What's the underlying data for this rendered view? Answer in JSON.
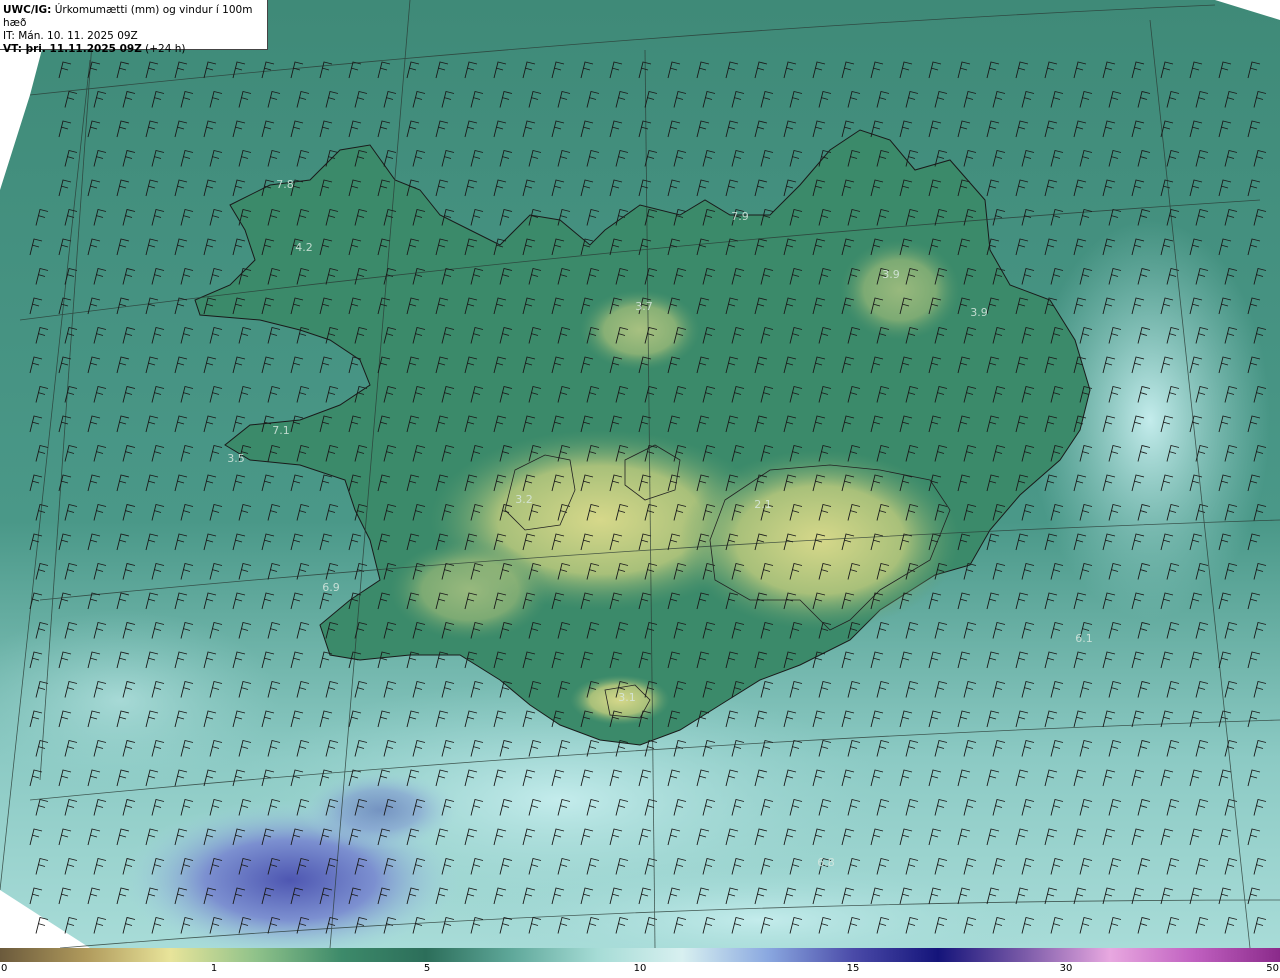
{
  "header": {
    "line1_bold": "UWC/IG:",
    "line1_rest": " Úrkomumætti (mm) og vindur í 100m hæð",
    "line2": "IT: Mán. 10. 11. 2025 09Z",
    "line3_bold": "VT: þri. 11.11.2025 09Z",
    "line3_rest": " (+24 h)"
  },
  "map_labels": [
    "7.8",
    "4.2",
    "3.7",
    "7.9",
    "3.9",
    "3.9",
    "7.1",
    "3.5",
    "3.2",
    "2.1",
    "6.9",
    "6.1",
    "3.1",
    "6.8"
  ],
  "colorbar": {
    "ticks": [
      "0",
      "1",
      "5",
      "10",
      "15",
      "30",
      "50"
    ],
    "colors": [
      "#6b5a3c",
      "#b09a5c",
      "#e8e49a",
      "#8fc28a",
      "#3d8a6a",
      "#2c6e5a",
      "#5fa89a",
      "#a6dcd6",
      "#d8f0f0",
      "#8aa8e0",
      "#4a4aa8",
      "#14147a",
      "#7a5aa8",
      "#e8a8e0",
      "#c060c0",
      "#8a2a8a"
    ]
  }
}
